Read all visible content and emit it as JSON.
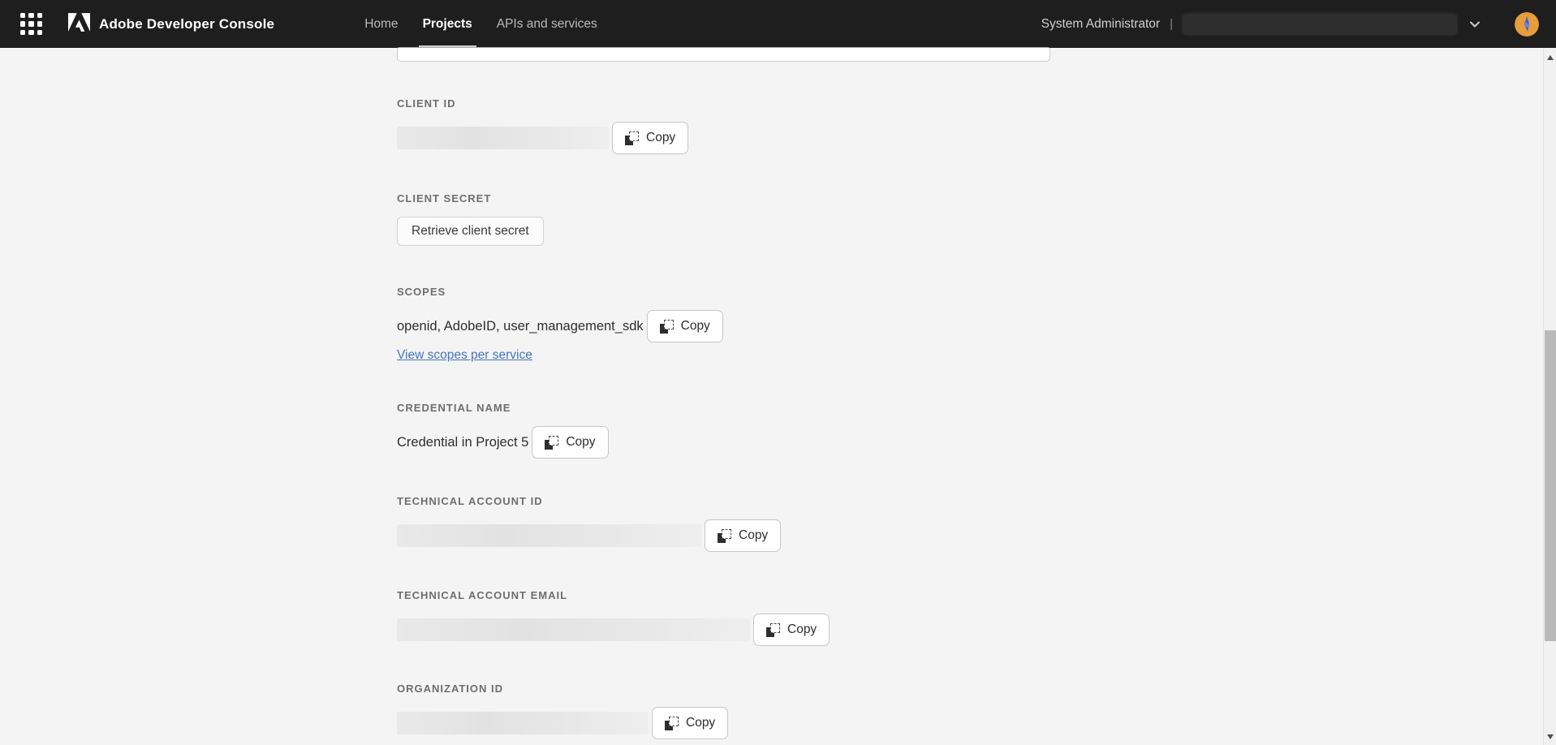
{
  "nav": {
    "brand": "Adobe Developer Console",
    "items": [
      {
        "label": "Home",
        "active": false
      },
      {
        "label": "Projects",
        "active": true
      },
      {
        "label": "APIs and services",
        "active": false
      }
    ],
    "user": {
      "role": "System Administrator",
      "separator": "|",
      "org_value_redacted": true
    }
  },
  "icons": {
    "grid_icon": "3x3-dot-app-launcher",
    "adobe_logo": "adobe-a-mark",
    "copy_icon": "two-overlapping-squares-dashed",
    "chevron_down_icon": "v-chevron",
    "scroll_up_icon": "triangle-up",
    "scroll_down_icon": "triangle-down"
  },
  "sections": [
    {
      "label": "CLIENT ID",
      "value_kind": "redacted",
      "copy": "Copy"
    },
    {
      "label": "CLIENT SECRET",
      "value_kind": "button",
      "button_label": "Retrieve client secret"
    },
    {
      "label": "SCOPES",
      "value_kind": "text",
      "value": "openid, AdobeID, user_management_sdk",
      "copy": "Copy",
      "link": "View scopes per service"
    },
    {
      "label": "CREDENTIAL NAME",
      "value_kind": "text",
      "value": "Credential in Project 5",
      "copy": "Copy"
    },
    {
      "label": "TECHNICAL ACCOUNT ID",
      "value_kind": "redacted",
      "copy": "Copy"
    },
    {
      "label": "TECHNICAL ACCOUNT EMAIL",
      "value_kind": "redacted",
      "copy": "Copy"
    },
    {
      "label": "ORGANIZATION ID",
      "value_kind": "redacted",
      "copy": "Copy"
    }
  ],
  "colors": {
    "nav_bg": "#1e1e1e",
    "page_bg": "#f4f4f4",
    "link": "#4574c2",
    "nav_active_text": "#ffffff",
    "avatar_orange": "#e59d3e",
    "scroll_thumb": "#b9b9b9"
  }
}
